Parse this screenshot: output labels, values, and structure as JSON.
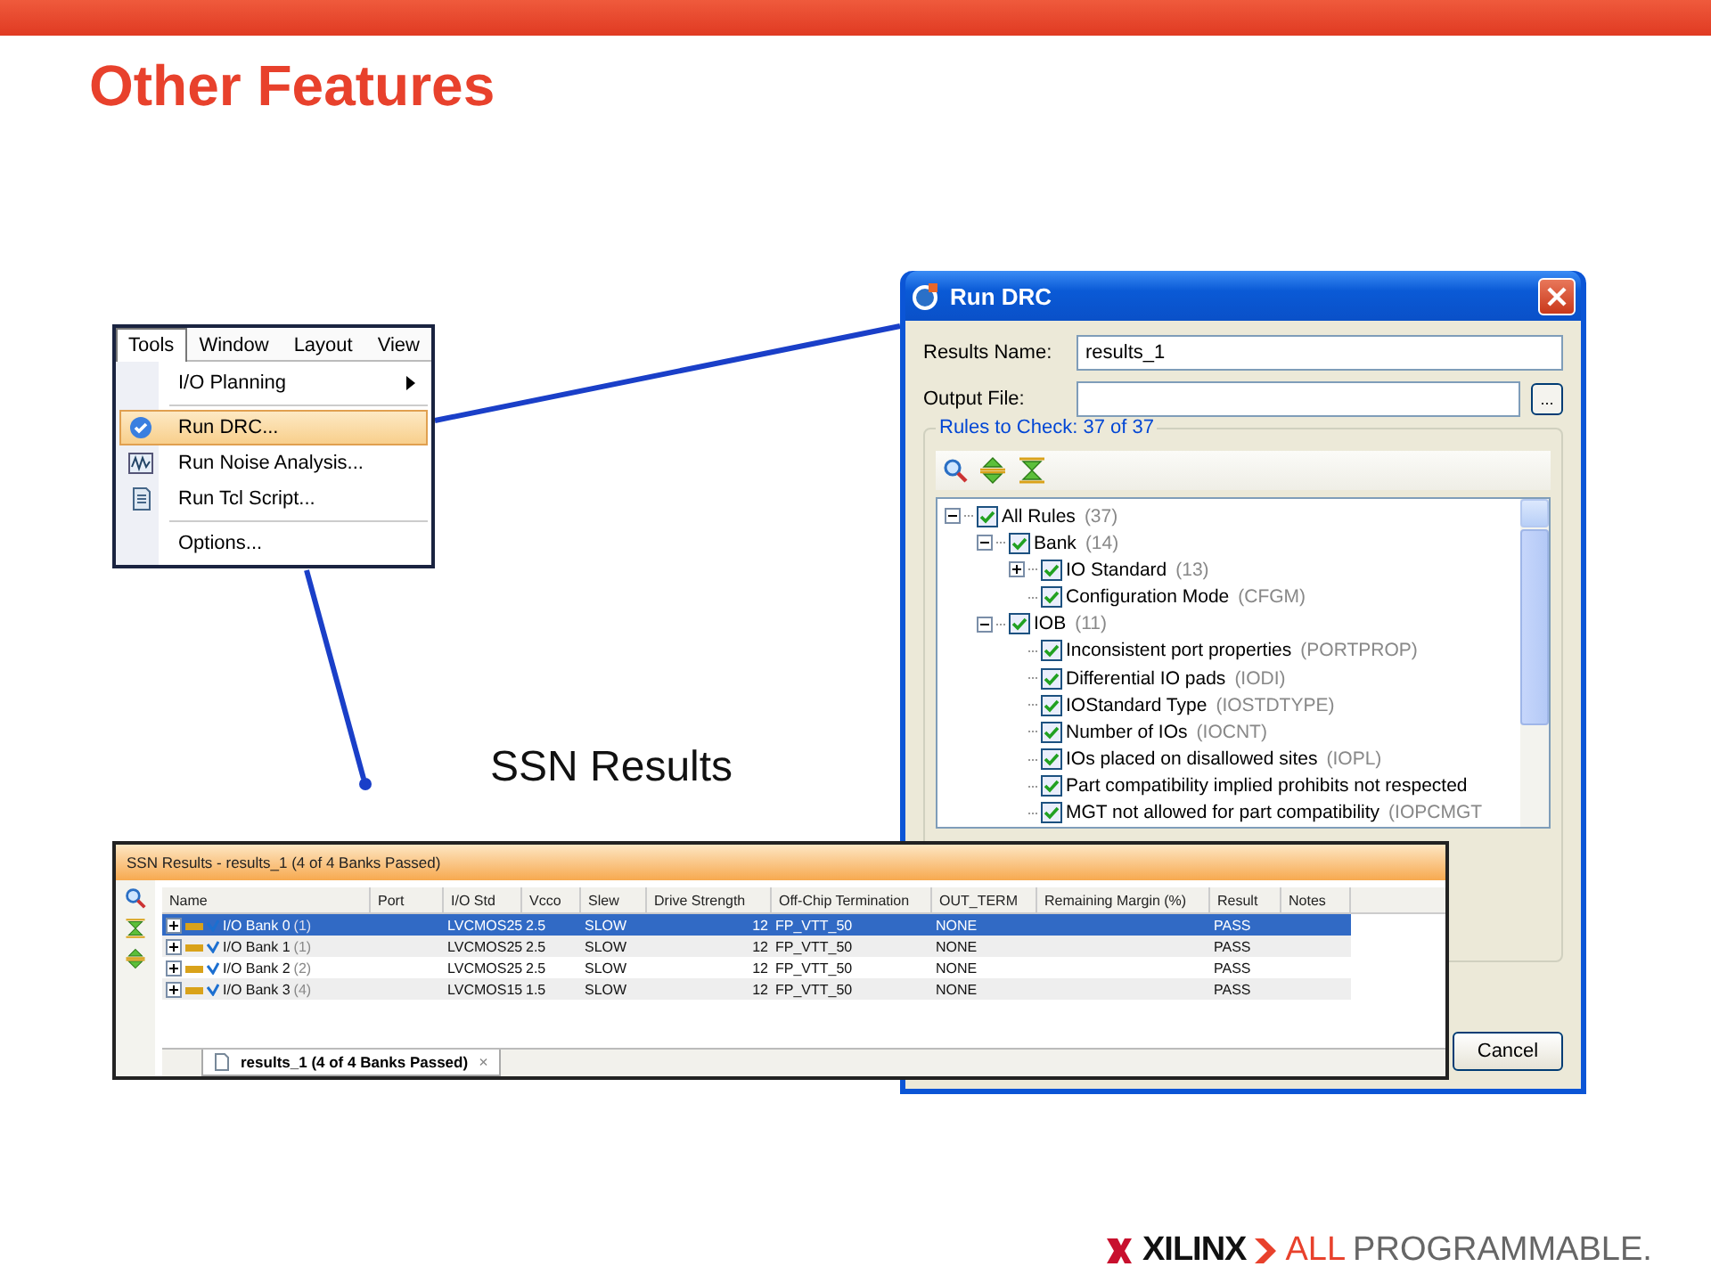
{
  "slide": {
    "title": "Other Features",
    "caption": "SSN Results"
  },
  "menu": {
    "menubar": [
      {
        "label": "Tools",
        "selected": true
      },
      {
        "label": "Window",
        "selected": false
      },
      {
        "label": "Layout",
        "selected": false
      },
      {
        "label": "View",
        "selected": false
      }
    ],
    "items": [
      {
        "kind": "submenu",
        "label": "I/O Planning",
        "selected": false
      },
      {
        "kind": "separator"
      },
      {
        "kind": "action",
        "label": "Run DRC...",
        "selected": true
      },
      {
        "kind": "action",
        "label": "Run Noise Analysis...",
        "selected": false
      },
      {
        "kind": "action",
        "label": "Run Tcl Script...",
        "selected": false
      },
      {
        "kind": "separator"
      },
      {
        "kind": "action",
        "label": "Options...",
        "selected": false
      }
    ]
  },
  "dialog": {
    "title": "Run DRC",
    "fields": [
      {
        "label": "Results Name:",
        "value": "results_1"
      },
      {
        "label": "Output File:",
        "browse_button": "..."
      }
    ],
    "group_title": "Rules to Check: 37 of 37",
    "tree": [
      {
        "label": "All Rules",
        "count": "(37)",
        "checked": true,
        "expanded": true,
        "children": [
          {
            "label": "Bank",
            "count": "(14)",
            "checked": true,
            "expanded": true,
            "children": [
              {
                "label": "IO Standard",
                "count": "(13)",
                "checked": true,
                "expanded": false
              },
              {
                "label": "Configuration Mode",
                "count": "(CFGM)",
                "checked": true
              }
            ]
          },
          {
            "label": "IOB",
            "count": "(11)",
            "checked": true,
            "expanded": true,
            "children": [
              {
                "label": "Inconsistent port properties",
                "count": "(PORTPROP)",
                "checked": true
              },
              {
                "label": "Differential IO pads",
                "count": "(IODI)",
                "checked": true
              },
              {
                "label": "IOStandard Type",
                "count": "(IOSTDTYPE)",
                "checked": true
              },
              {
                "label": "Number of IOs",
                "count": "(IOCNT)",
                "checked": true
              },
              {
                "label": "IOs placed on disallowed sites",
                "count": "(IOPL)",
                "checked": true
              },
              {
                "label": "Part compatibility implied prohibits not respected",
                "checked": true
              },
              {
                "label": "MGT not allowed for part compatibility",
                "count": "(IOPCMGT",
                "checked": true
              }
            ]
          }
        ]
      }
    ],
    "cancel_button": "Cancel"
  },
  "ssn": {
    "title": "SSN Results - results_1 (4 of 4 Banks Passed)",
    "columns": [
      "Name",
      "Port",
      "I/O Std",
      "Vcco",
      "Slew",
      "Drive Strength",
      "Off-Chip Termination",
      "OUT_TERM",
      "Remaining Margin (%)",
      "Result",
      "Notes"
    ],
    "rows": [
      {
        "name": "I/O Bank 0",
        "count": "(1)",
        "io_std": "LVCMOS25",
        "vcco": "2.5",
        "slew": "SLOW",
        "drive": "12",
        "termination": "FP_VTT_50",
        "out_term": "NONE",
        "result": "PASS",
        "selected": true
      },
      {
        "name": "I/O Bank 1",
        "count": "(1)",
        "io_std": "LVCMOS25",
        "vcco": "2.5",
        "slew": "SLOW",
        "drive": "12",
        "termination": "FP_VTT_50",
        "out_term": "NONE",
        "result": "PASS",
        "selected": false
      },
      {
        "name": "I/O Bank 2",
        "count": "(2)",
        "io_std": "LVCMOS25",
        "vcco": "2.5",
        "slew": "SLOW",
        "drive": "12",
        "termination": "FP_VTT_50",
        "out_term": "NONE",
        "result": "PASS",
        "selected": false
      },
      {
        "name": "I/O Bank 3",
        "count": "(4)",
        "io_std": "LVCMOS15",
        "vcco": "1.5",
        "slew": "SLOW",
        "drive": "12",
        "termination": "FP_VTT_50",
        "out_term": "NONE",
        "result": "PASS",
        "selected": false
      }
    ],
    "tab": "results_1 (4 of 4 Banks Passed)",
    "tab_close": "×"
  },
  "logo": {
    "brand": "XILINX",
    "tagline_accent": "ALL",
    "tagline": "PROGRAMMABLE."
  }
}
